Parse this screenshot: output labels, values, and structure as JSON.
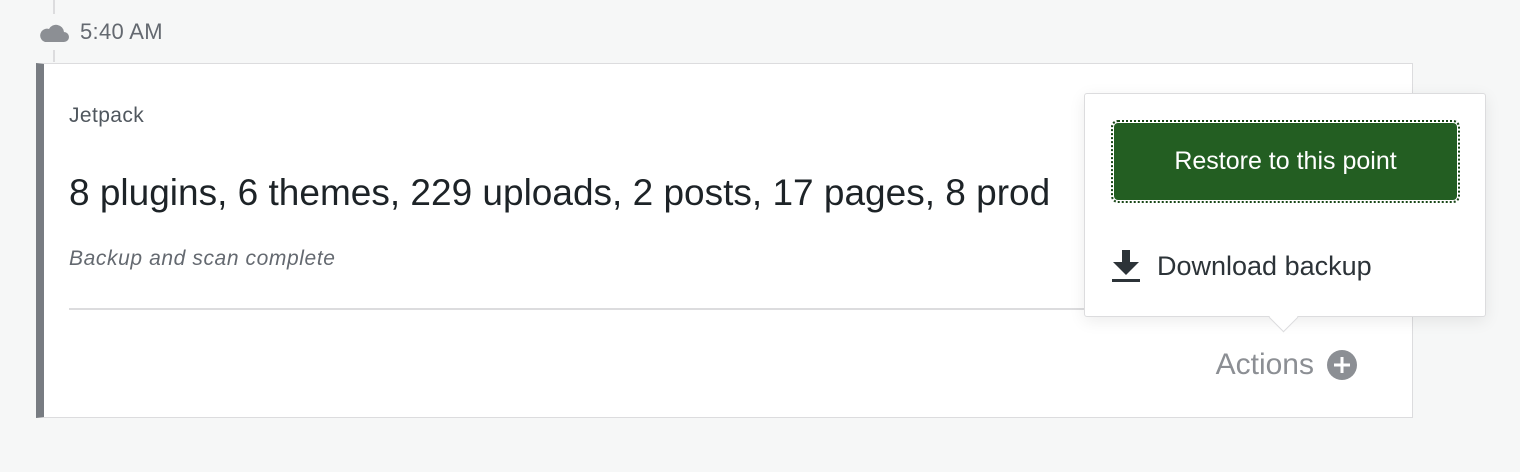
{
  "timeline": {
    "time": "5:40 AM",
    "icon": "cloud-icon"
  },
  "card": {
    "source": "Jetpack",
    "summary": "8 plugins, 6 themes, 229 uploads, 2 posts, 17 pages, 8 prod",
    "status": "Backup and scan complete",
    "accent_color": "#787c82",
    "actions_label": "Actions",
    "actions_icon": "plus-circle-icon"
  },
  "popover": {
    "restore_label": "Restore to this point",
    "restore_color": "#235e22",
    "download_label": "Download backup",
    "download_icon": "download-icon"
  }
}
